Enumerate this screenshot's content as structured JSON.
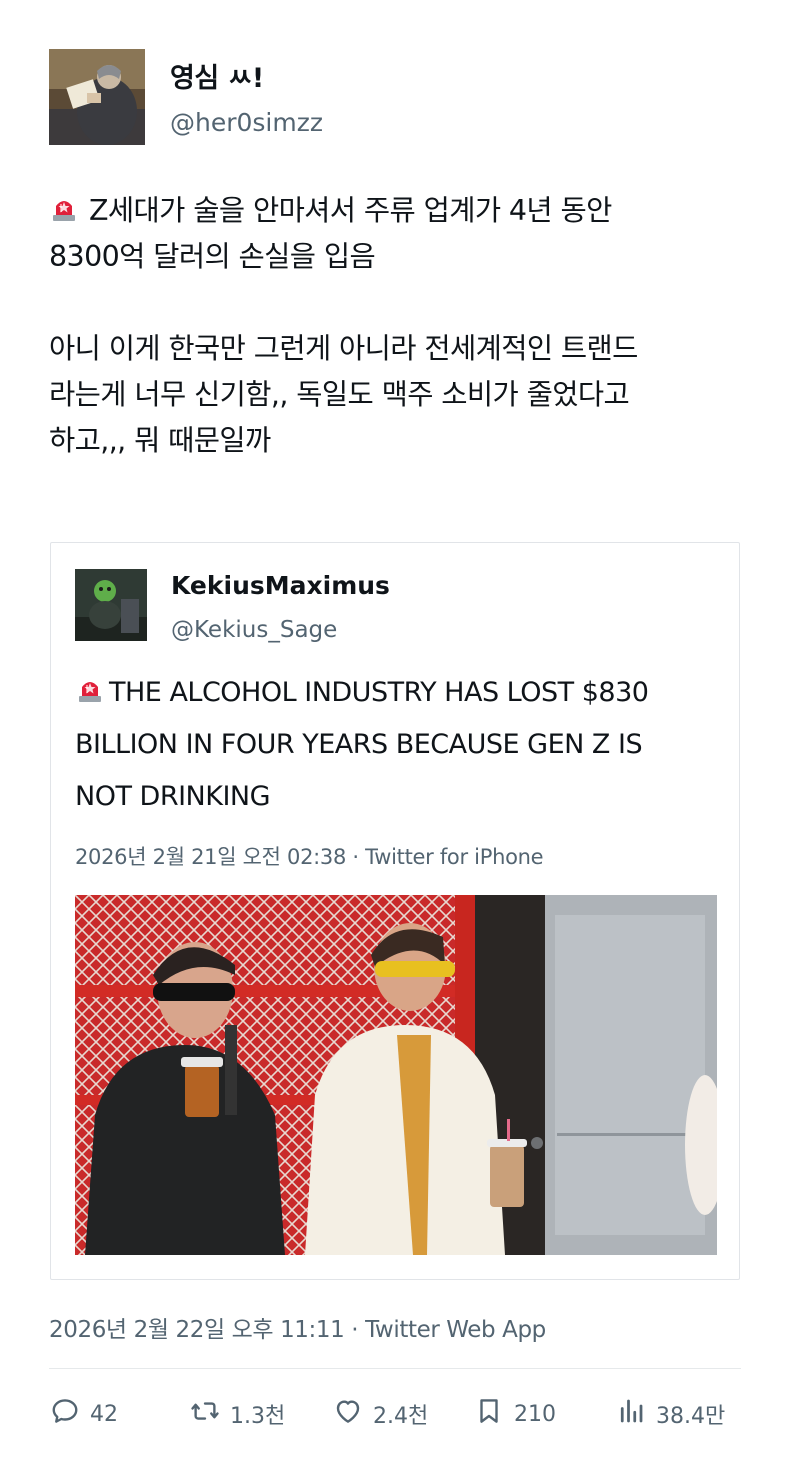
{
  "tweet": {
    "author_name": "영심 ㅆ!",
    "author_handle": "@her0simzz",
    "body_line1": "Z세대가 술을 안마셔서 주류 업계가 4년 동안",
    "body_line2": "8300억 달러의 손실을 입음",
    "body_line3": "아니 이게 한국만 그런게 아니라 전세계적인 트랜드",
    "body_line4": "라는게 너무 신기함,, 독일도 맥주 소비가 줄었다고",
    "body_line5": "하고,,, 뭐 때문일까",
    "timestamp": "2026년 2월 22일 오후 11:11 · Twitter Web App"
  },
  "quoted": {
    "author_name": "KekiusMaximus",
    "author_handle": "@Kekius_Sage",
    "text_line1": "THE ALCOHOL INDUSTRY HAS LOST $830",
    "text_line2": "BILLION IN FOUR YEARS BECAUSE GEN Z IS",
    "text_line3": "NOT DRINKING",
    "timestamp": "2026년 2월 21일 오전 02:38 · Twitter for iPhone"
  },
  "actions": {
    "replies": "42",
    "retweets": "1.3천",
    "likes": "2.4천",
    "bookmarks": "210",
    "views": "38.4만"
  },
  "icons": {
    "siren": "siren-emoji-icon",
    "reply": "reply-icon",
    "retweet": "retweet-icon",
    "like": "heart-icon",
    "bookmark": "bookmark-icon",
    "views": "views-icon"
  },
  "colors": {
    "text_primary": "#0f1419",
    "text_secondary": "#536471",
    "border": "#e1e4e8"
  }
}
